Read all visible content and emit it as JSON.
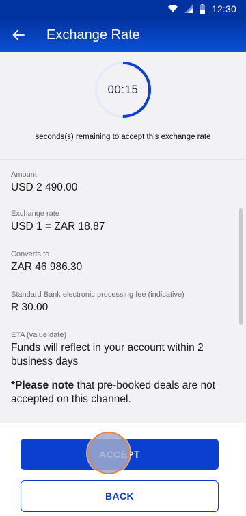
{
  "status_bar": {
    "time": "12:30"
  },
  "header": {
    "title": "Exchange Rate"
  },
  "timer": {
    "display": "00:15",
    "fraction_remaining": 0.5,
    "caption": "seconds(s) remaining to accept this exchange rate"
  },
  "details": {
    "amount": {
      "label": "Amount",
      "value": "USD 2 490.00"
    },
    "exchange_rate": {
      "label": "Exchange rate",
      "value": "USD 1 = ZAR 18.87"
    },
    "converts_to": {
      "label": "Converts to",
      "value": "ZAR 46 986.30"
    },
    "fee": {
      "label": "Standard Bank electronic processing fee (indicative)",
      "value": "R 30.00"
    },
    "eta": {
      "label": "ETA (value date)",
      "value": "Funds will reflect in your account within 2 business days"
    }
  },
  "note": {
    "bold": "*Please note",
    "rest": " that pre-booked deals are not accepted on this channel."
  },
  "buttons": {
    "accept": "ACCEPT",
    "back": "BACK"
  },
  "colors": {
    "brand_blue": "#0033a0",
    "button_blue": "#0a3fd0",
    "timer_track": "#e4ecf9"
  }
}
